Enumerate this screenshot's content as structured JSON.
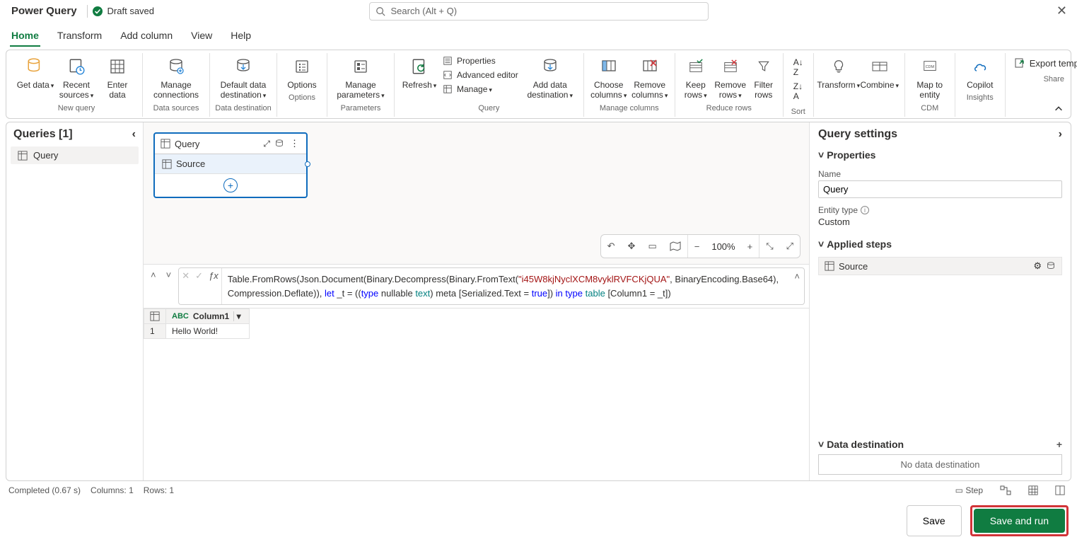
{
  "title": "Power Query",
  "draftSavedLabel": "Draft saved",
  "searchPlaceholder": "Search (Alt + Q)",
  "tabs": [
    "Home",
    "Transform",
    "Add column",
    "View",
    "Help"
  ],
  "activeTab": "Home",
  "ribbon": {
    "groups": {
      "newQuery": "New query",
      "dataSources": "Data sources",
      "dataDestination": "Data destination",
      "options": "Options",
      "parameters": "Parameters",
      "query": "Query",
      "manageColumns": "Manage columns",
      "reduceRows": "Reduce rows",
      "sort": "Sort",
      "cdm": "CDM",
      "insights": "Insights",
      "share": "Share"
    },
    "items": {
      "getData": "Get data",
      "recentSources": "Recent sources",
      "enterData": "Enter data",
      "manageConnections": "Manage connections",
      "defaultDataDestination": "Default data destination",
      "optionsBtn": "Options",
      "manageParameters": "Manage parameters",
      "refresh": "Refresh",
      "properties": "Properties",
      "advancedEditor": "Advanced editor",
      "manage": "Manage",
      "addDataDestination": "Add data destination",
      "chooseColumns": "Choose columns",
      "removeColumns": "Remove columns",
      "keepRows": "Keep rows",
      "removeRows": "Remove rows",
      "filterRows": "Filter rows",
      "transform": "Transform",
      "combine": "Combine",
      "mapToEntity": "Map to entity",
      "copilot": "Copilot",
      "exportTemplate": "Export template"
    }
  },
  "queriesPane": {
    "header": "Queries [1]",
    "items": [
      "Query"
    ]
  },
  "diagram": {
    "cardTitle": "Query",
    "stepLabel": "Source"
  },
  "canvasTools": {
    "zoom": "100%"
  },
  "formula": {
    "p1": "Table.FromRows(Json.Document(Binary.Decompress(Binary.FromText(",
    "str": "\"i45W8kjNyclXCM8vyklRVFCKjQUA\"",
    "p2": ", BinaryEncoding.Base64), Compression.Deflate)), ",
    "kwLet": "let",
    "p3": " _t = ((",
    "kwType1": "type",
    "p4": " nullable ",
    "typTok": "text",
    "p5": ") meta [Serialized.Text = ",
    "boolTok": "true",
    "p6": "]) ",
    "kwIn": "in",
    "p7": " ",
    "kwType2": "type",
    "p8": " ",
    "tblTok": "table",
    "p9": " [Column1 = _t])"
  },
  "preview": {
    "columns": [
      "Column1"
    ],
    "rows": [
      [
        "Hello World!"
      ]
    ]
  },
  "settings": {
    "header": "Query settings",
    "properties": "Properties",
    "nameLabel": "Name",
    "nameValue": "Query",
    "entityTypeLabel": "Entity type",
    "entityTypeValue": "Custom",
    "appliedStepsTitle": "Applied steps",
    "steps": [
      "Source"
    ],
    "dataDestinationTitle": "Data destination",
    "noDataDestination": "No data destination"
  },
  "status": {
    "completed": "Completed (0.67 s)",
    "columns": "Columns: 1",
    "rows": "Rows: 1",
    "stepLabel": "Step"
  },
  "footer": {
    "save": "Save",
    "saveAndRun": "Save and run"
  }
}
